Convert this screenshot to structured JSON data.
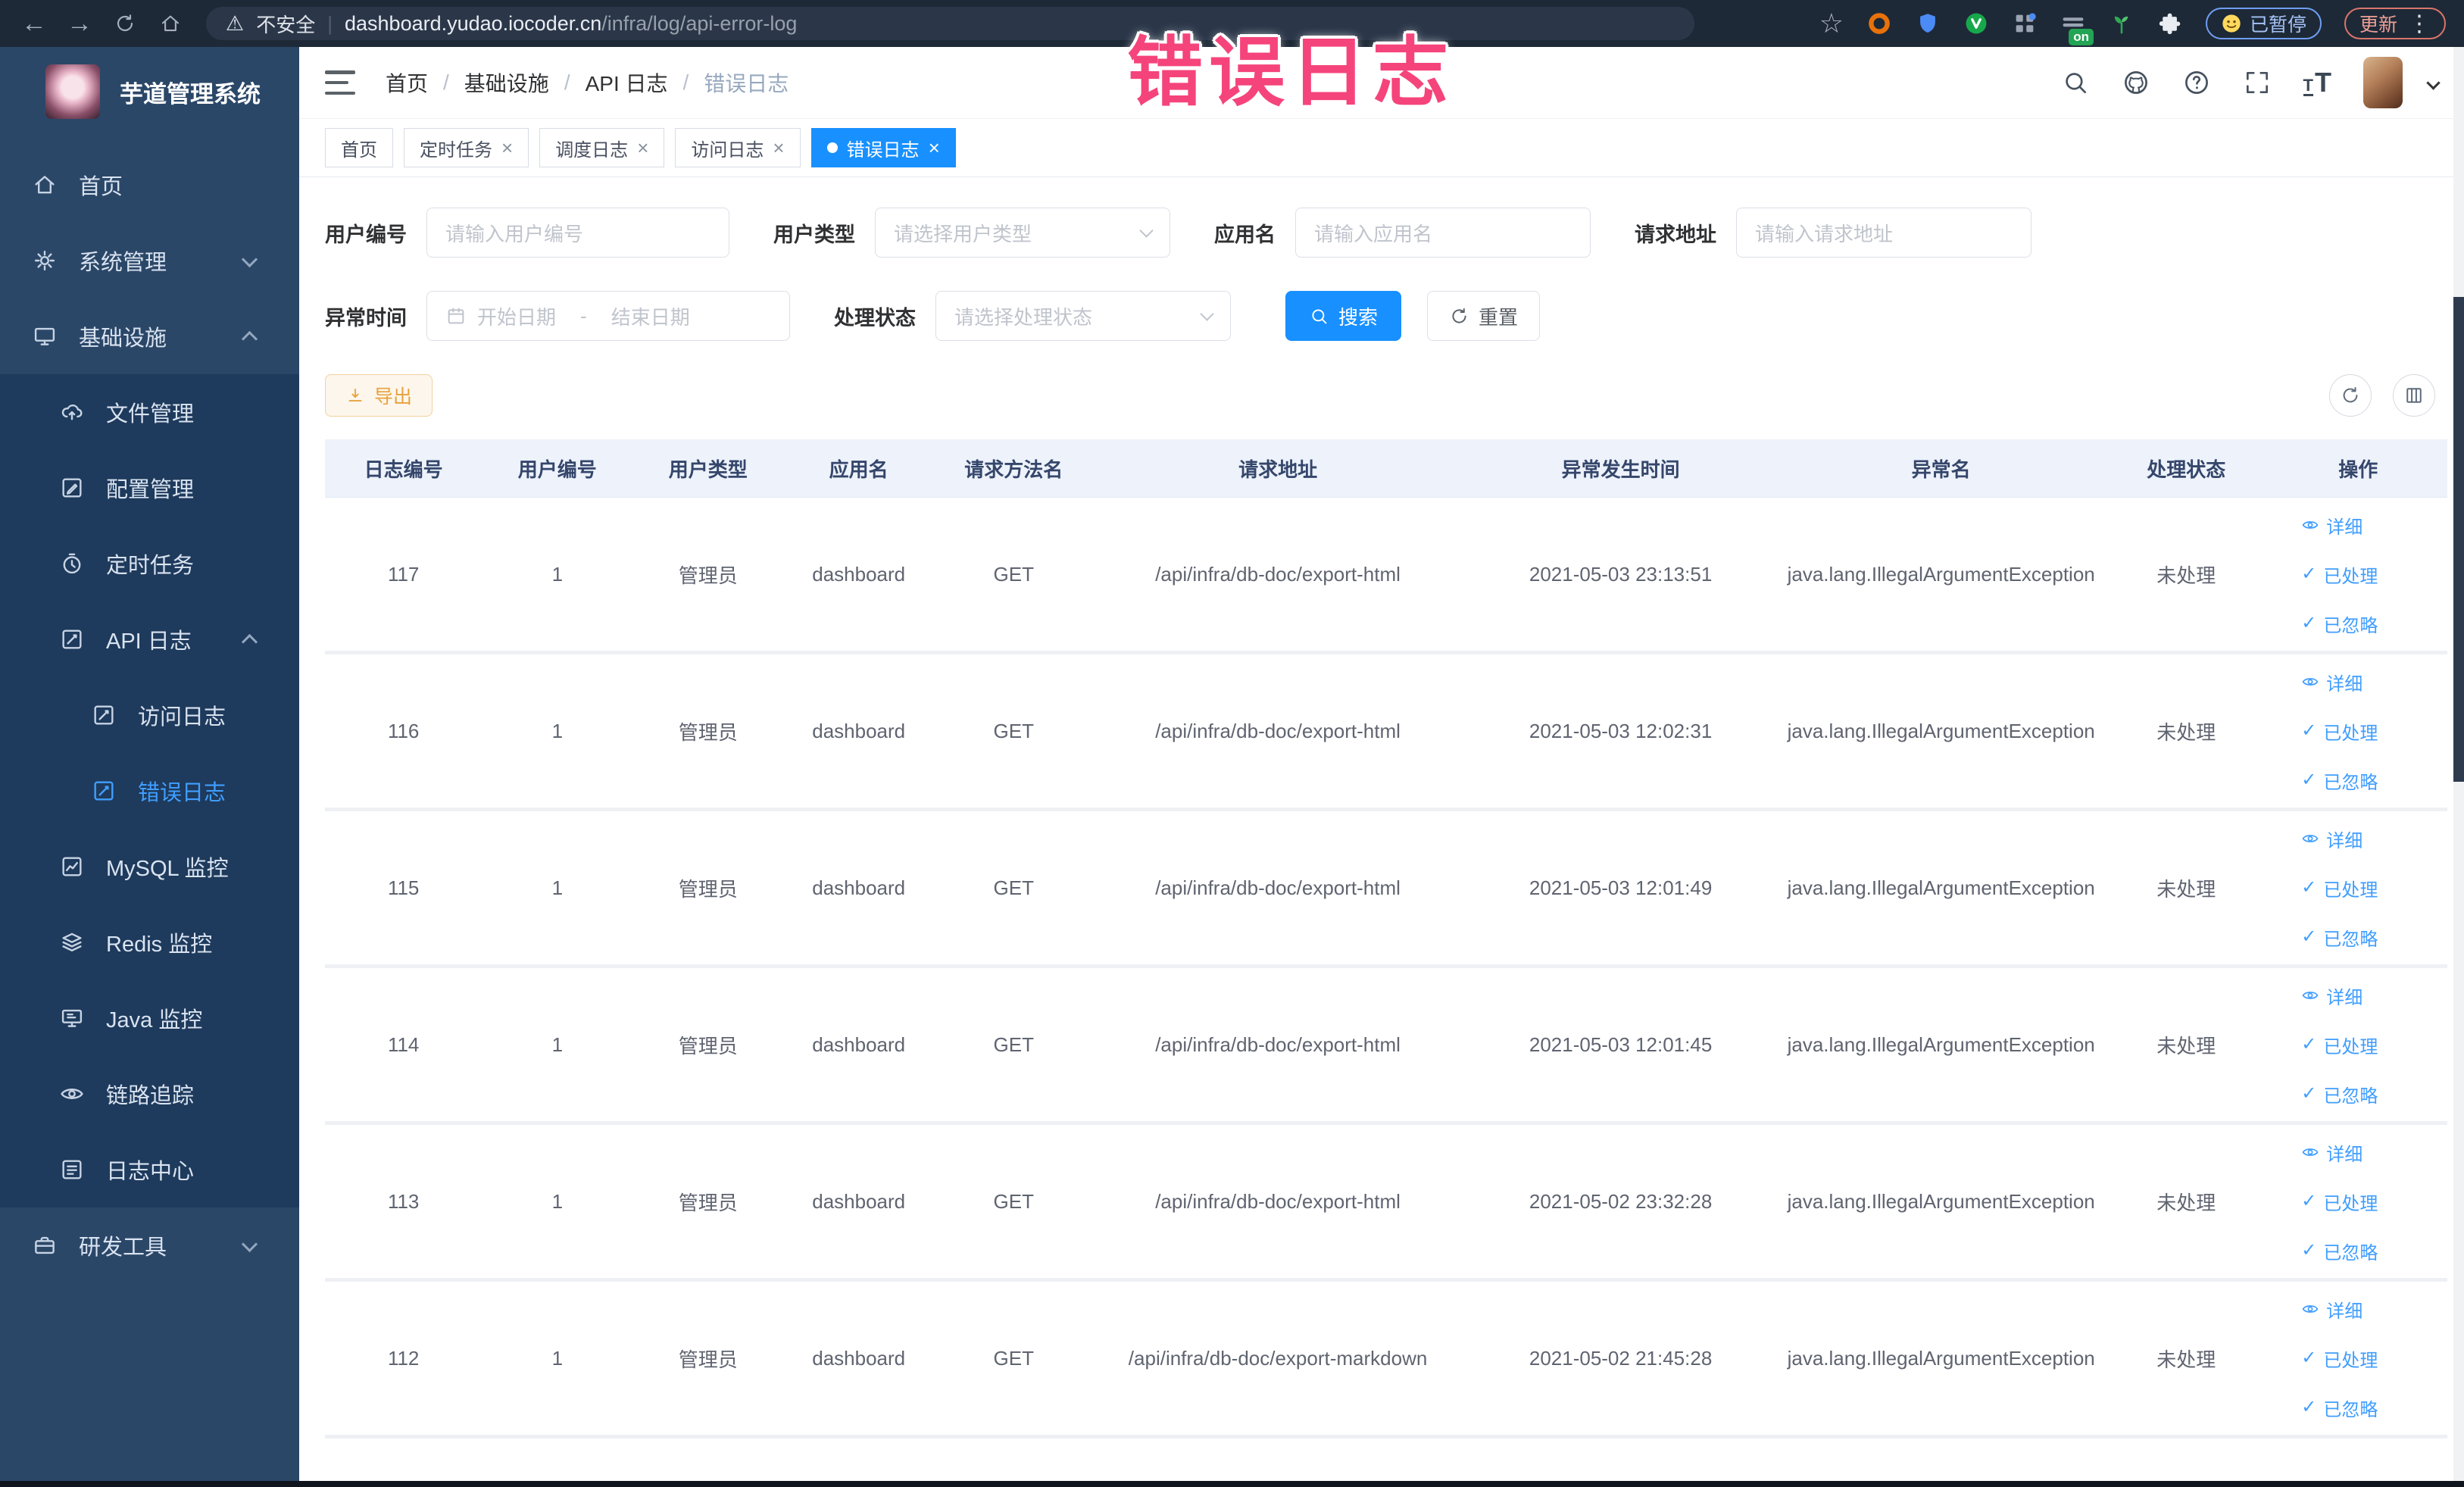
{
  "browser": {
    "security_label": "不安全",
    "url_host": "dashboard.yudao.iocoder.cn",
    "url_path": "/infra/log/api-error-log",
    "paused_badge": "已暂停",
    "update_badge": "更新",
    "on_badge": "on"
  },
  "overlay": {
    "text": "错误日志",
    "color": "#f5447b"
  },
  "icons": {
    "security_warning": "⚠",
    "star": "☆",
    "check": "✓",
    "kebab": "⋮",
    "back_arrow": "←",
    "forward_arrow": "→"
  },
  "colors": {
    "accent": "#409eff",
    "active_tab": "#1890ff",
    "warning": "#e6a23c",
    "sidebar_bg": "#2b4768",
    "submenu_bg": "#1e3a5c",
    "table_header_bg": "#edf2fb"
  },
  "sidebar": {
    "title": "芋道管理系统",
    "items": [
      {
        "key": "home",
        "label": "首页",
        "icon": "home-icon",
        "level": 0
      },
      {
        "key": "system",
        "label": "系统管理",
        "icon": "gear-icon",
        "level": 0,
        "chevron": "down"
      },
      {
        "key": "infra",
        "label": "基础设施",
        "icon": "infra-icon",
        "level": 0,
        "chevron": "up"
      },
      {
        "key": "file",
        "label": "文件管理",
        "icon": "cloud-upload-icon",
        "level": 1,
        "dark": true
      },
      {
        "key": "config",
        "label": "配置管理",
        "icon": "config-edit-icon",
        "level": 1,
        "dark": true
      },
      {
        "key": "job",
        "label": "定时任务",
        "icon": "timer-icon",
        "level": 1,
        "dark": true
      },
      {
        "key": "api-log",
        "label": "API 日志",
        "icon": "log-doc-icon",
        "level": 1,
        "dark": true,
        "chevron": "up"
      },
      {
        "key": "access-log",
        "label": "访问日志",
        "icon": "log-doc-icon",
        "level": 2,
        "dark": true
      },
      {
        "key": "error-log",
        "label": "错误日志",
        "icon": "log-doc-icon",
        "level": 2,
        "dark": true,
        "active": true
      },
      {
        "key": "mysql",
        "label": "MySQL 监控",
        "icon": "chart-icon",
        "level": 1,
        "dark": true
      },
      {
        "key": "redis",
        "label": "Redis 监控",
        "icon": "layers-icon",
        "level": 1,
        "dark": true
      },
      {
        "key": "java",
        "label": "Java 监控",
        "icon": "monitor-icon",
        "level": 1,
        "dark": true
      },
      {
        "key": "trace",
        "label": "链路追踪",
        "icon": "eye-icon",
        "level": 1,
        "dark": true
      },
      {
        "key": "log-center",
        "label": "日志中心",
        "icon": "doc-lines-icon",
        "level": 1,
        "dark": true
      },
      {
        "key": "dev-tools",
        "label": "研发工具",
        "icon": "briefcase-icon",
        "level": 0,
        "chevron": "down"
      }
    ]
  },
  "header": {
    "breadcrumb": [
      "首页",
      "基础设施",
      "API 日志",
      "错误日志"
    ]
  },
  "tabs": [
    {
      "key": "home",
      "label": "首页",
      "closable": false,
      "active": false
    },
    {
      "key": "job",
      "label": "定时任务",
      "closable": true,
      "active": false
    },
    {
      "key": "job-log",
      "label": "调度日志",
      "closable": true,
      "active": false
    },
    {
      "key": "access-log",
      "label": "访问日志",
      "closable": true,
      "active": false
    },
    {
      "key": "error-log",
      "label": "错误日志",
      "closable": true,
      "active": true
    }
  ],
  "filters": {
    "user_id": {
      "label": "用户编号",
      "placeholder": "请输入用户编号"
    },
    "user_type": {
      "label": "用户类型",
      "placeholder": "请选择用户类型"
    },
    "app_name": {
      "label": "应用名",
      "placeholder": "请输入应用名"
    },
    "request_url": {
      "label": "请求地址",
      "placeholder": "请输入请求地址"
    },
    "exception_time": {
      "label": "异常时间",
      "start_placeholder": "开始日期",
      "separator": "-",
      "end_placeholder": "结束日期"
    },
    "process_status": {
      "label": "处理状态",
      "placeholder": "请选择处理状态"
    },
    "search_button": "搜索",
    "reset_button": "重置"
  },
  "toolbar": {
    "export_button": "导出"
  },
  "table": {
    "columns": [
      "日志编号",
      "用户编号",
      "用户类型",
      "应用名",
      "请求方法名",
      "请求地址",
      "异常发生时间",
      "异常名",
      "处理状态",
      "操作"
    ],
    "action_labels": {
      "detail": "详细",
      "processed": "已处理",
      "ignored": "已忽略"
    },
    "rows": [
      {
        "id": "117",
        "user_id": "1",
        "user_type": "管理员",
        "app": "dashboard",
        "method": "GET",
        "url": "/api/infra/db-doc/export-html",
        "time": "2021-05-03 23:13:51",
        "exception": "java.lang.IllegalArgumentException",
        "status": "未处理"
      },
      {
        "id": "116",
        "user_id": "1",
        "user_type": "管理员",
        "app": "dashboard",
        "method": "GET",
        "url": "/api/infra/db-doc/export-html",
        "time": "2021-05-03 12:02:31",
        "exception": "java.lang.IllegalArgumentException",
        "status": "未处理"
      },
      {
        "id": "115",
        "user_id": "1",
        "user_type": "管理员",
        "app": "dashboard",
        "method": "GET",
        "url": "/api/infra/db-doc/export-html",
        "time": "2021-05-03 12:01:49",
        "exception": "java.lang.IllegalArgumentException",
        "status": "未处理"
      },
      {
        "id": "114",
        "user_id": "1",
        "user_type": "管理员",
        "app": "dashboard",
        "method": "GET",
        "url": "/api/infra/db-doc/export-html",
        "time": "2021-05-03 12:01:45",
        "exception": "java.lang.IllegalArgumentException",
        "status": "未处理"
      },
      {
        "id": "113",
        "user_id": "1",
        "user_type": "管理员",
        "app": "dashboard",
        "method": "GET",
        "url": "/api/infra/db-doc/export-html",
        "time": "2021-05-02 23:32:28",
        "exception": "java.lang.IllegalArgumentException",
        "status": "未处理"
      },
      {
        "id": "112",
        "user_id": "1",
        "user_type": "管理员",
        "app": "dashboard",
        "method": "GET",
        "url": "/api/infra/db-doc/export-markdown",
        "time": "2021-05-02 21:45:28",
        "exception": "java.lang.IllegalArgumentException",
        "status": "未处理"
      }
    ]
  }
}
